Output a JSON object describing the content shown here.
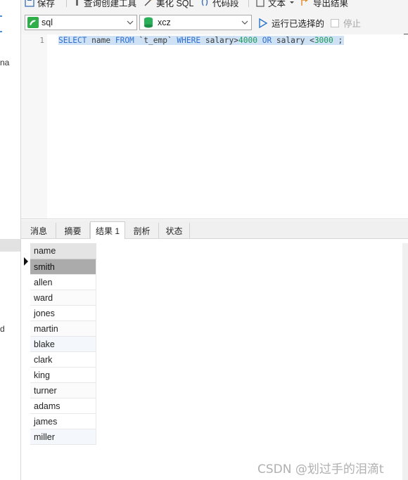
{
  "toolbar": {
    "save_label": "保存",
    "query_builder_label": "查询创建工具",
    "beautify_label": "美化 SQL",
    "snippet_label": "代码段",
    "text_label": "文本",
    "export_label": "导出结果"
  },
  "connection_select": {
    "value": "sql"
  },
  "database_select": {
    "value": "xcz"
  },
  "run_selected_label": "运行已选择的",
  "stop_label": "停止",
  "editor": {
    "line_number": "1",
    "sql_parts": {
      "kw1": "SELECT",
      "t1": " name ",
      "kw2": "FROM",
      "t2": " `t_emp` ",
      "kw3": "WHERE",
      "t3": " salary>",
      "n1": "4000",
      "t4": " ",
      "kw4": "OR",
      "t5": " salary <",
      "n2": "3000",
      "t6": " ;"
    }
  },
  "result_tabs": [
    "消息",
    "摘要",
    "结果 1",
    "剖析",
    "状态"
  ],
  "active_tab": "结果 1",
  "grid": {
    "column_header": "name",
    "rows": [
      "smith",
      "allen",
      "ward",
      "jones",
      "martin",
      "blake",
      "clark",
      "king",
      "turner",
      "adams",
      "james",
      "miller"
    ],
    "selected_row": "smith"
  },
  "left_sidebar_fragments": [
    "na",
    "d"
  ],
  "watermark": "CSDN @划过手的泪滴t",
  "colors": {
    "keyword": "#2f6fd0",
    "number": "#1a9b57",
    "selection": "#cfe2f5"
  }
}
